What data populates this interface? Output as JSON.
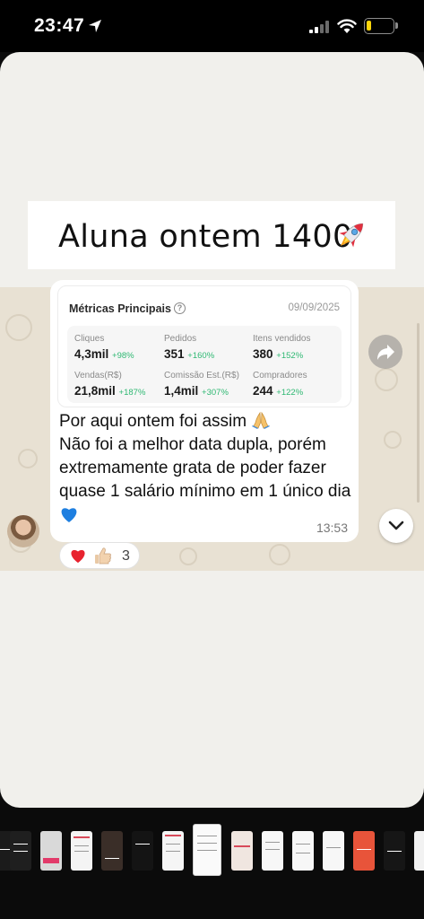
{
  "status_bar": {
    "time": "23:47",
    "battery_level": "20",
    "battery_fill_fraction": 0.2,
    "icons": [
      "location-arrow-icon",
      "cellular-signal-icon",
      "wifi-icon",
      "battery-icon"
    ]
  },
  "story": {
    "title": "Aluna ontem 1400",
    "title_emoji": "rocket-icon",
    "metrics_card": {
      "title": "Métricas Principais",
      "date": "09/09/2025",
      "metrics": [
        {
          "label": "Cliques",
          "value": "4,3mil",
          "delta": "+98%"
        },
        {
          "label": "Pedidos",
          "value": "351",
          "delta": "+160%"
        },
        {
          "label": "Itens vendidos",
          "value": "380",
          "delta": "+152%"
        },
        {
          "label": "Vendas(R$)",
          "value": "21,8mil",
          "delta": "+187%"
        },
        {
          "label": "Comissão Est.(R$)",
          "value": "1,4mil",
          "delta": "+307%"
        },
        {
          "label": "Compradores",
          "value": "244",
          "delta": "+122%"
        }
      ]
    },
    "message": {
      "line1": "Por aqui ontem foi assim",
      "line2": "Não foi a melhor data dupla, porém extremamente grata de poder fazer quase 1 salário mínimo em 1 único dia",
      "time": "13:53"
    },
    "reactions": {
      "emojis": [
        "red-heart-icon",
        "thumbs-up-icon"
      ],
      "count": "3"
    },
    "colors": {
      "delta_green": "#2eb872",
      "chat_background": "#e8e1d3",
      "story_background": "#f1f0ec"
    }
  },
  "thumbnails": {
    "count": 14,
    "active_index": 6
  }
}
